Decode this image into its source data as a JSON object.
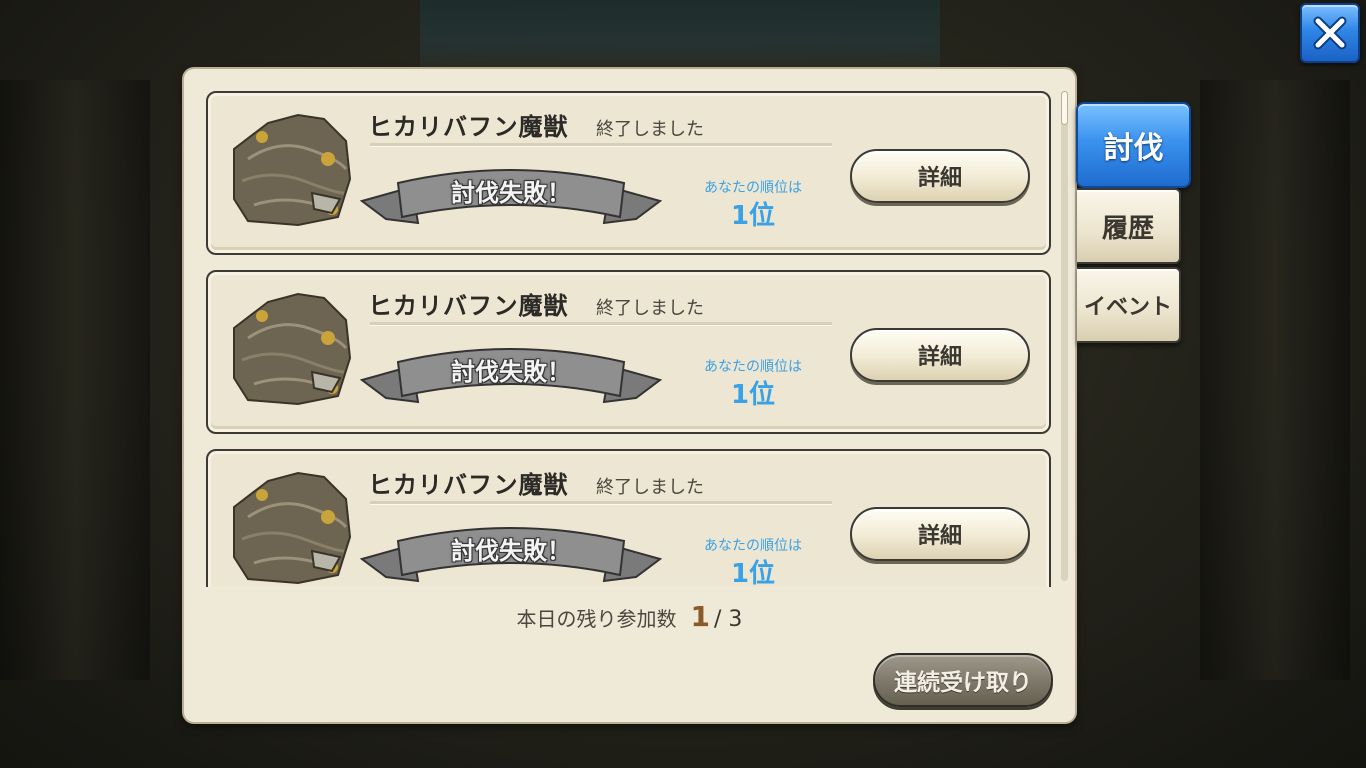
{
  "tabs": [
    {
      "label": "討伐",
      "active": true
    },
    {
      "label": "履歴",
      "active": false
    },
    {
      "label": "イベント",
      "active": false
    }
  ],
  "entries": [
    {
      "boss_name": "ヒカリバフン魔獣",
      "status": "終了しました",
      "result": "討伐失敗！",
      "rank_label": "あなたの順位は",
      "rank": "1位",
      "detail_label": "詳細"
    },
    {
      "boss_name": "ヒカリバフン魔獣",
      "status": "終了しました",
      "result": "討伐失敗！",
      "rank_label": "あなたの順位は",
      "rank": "1位",
      "detail_label": "詳細"
    },
    {
      "boss_name": "ヒカリバフン魔獣",
      "status": "終了しました",
      "result": "討伐失敗！",
      "rank_label": "あなたの順位は",
      "rank": "1位",
      "detail_label": "詳細"
    }
  ],
  "remaining": {
    "label": "本日の残り参加数",
    "current": "1",
    "total": "/ 3"
  },
  "collect_button": "連続受け取り",
  "icons": {
    "close": "close-icon",
    "boss": "boss-beast-icon",
    "ribbon": "ribbon-banner-icon"
  },
  "colors": {
    "accent_blue": "#3a92ee",
    "rank_blue": "#3aa1e6",
    "panel_bg": "#efe9d8"
  }
}
